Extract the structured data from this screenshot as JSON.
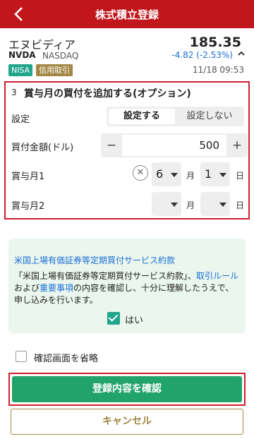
{
  "header": {
    "title": "株式積立登録"
  },
  "stock": {
    "name": "エヌビディア",
    "price": "185.35",
    "ticker": "NVDA",
    "market": "NASDAQ",
    "change": "-4.82 (-2.53%)",
    "badges": [
      "NISA",
      "信用取引"
    ],
    "time": "11/18 09:53"
  },
  "bonus": {
    "step": "3",
    "heading": "賞与月の買付を追加する(オプション)",
    "setting_label": "設定",
    "setting_on": "設定する",
    "setting_off": "設定しない",
    "amount_label": "買付金額(ドル)",
    "amount_value": "500",
    "minus": "−",
    "plus": "+",
    "month1_label": "賞与月1",
    "month1_month": "6",
    "month1_day": "1",
    "month2_label": "賞与月2",
    "month2_month": "",
    "month2_day": "",
    "unit_month": "月",
    "unit_day": "日",
    "clear": "✕"
  },
  "agreement": {
    "title": "米国上場有価証券等定期買付サービス約款",
    "text_pre": "「米国上場有価証券等定期買付サービス約款」、",
    "link_rule": "取引ルール",
    "text_mid": "および",
    "link_important": "重要事項",
    "text_post": "の内容を確認し、十分に理解したうえで、申し込みを行います。",
    "yes_label": "はい",
    "checked": true
  },
  "skip_confirm_label": "確認画面を省略",
  "buttons": {
    "confirm": "登録内容を確認",
    "cancel": "キャンセル"
  },
  "colors": {
    "header": "#c1161c",
    "accent_green": "#21a36a",
    "gold": "#a28745",
    "link": "#1a6fd6"
  }
}
